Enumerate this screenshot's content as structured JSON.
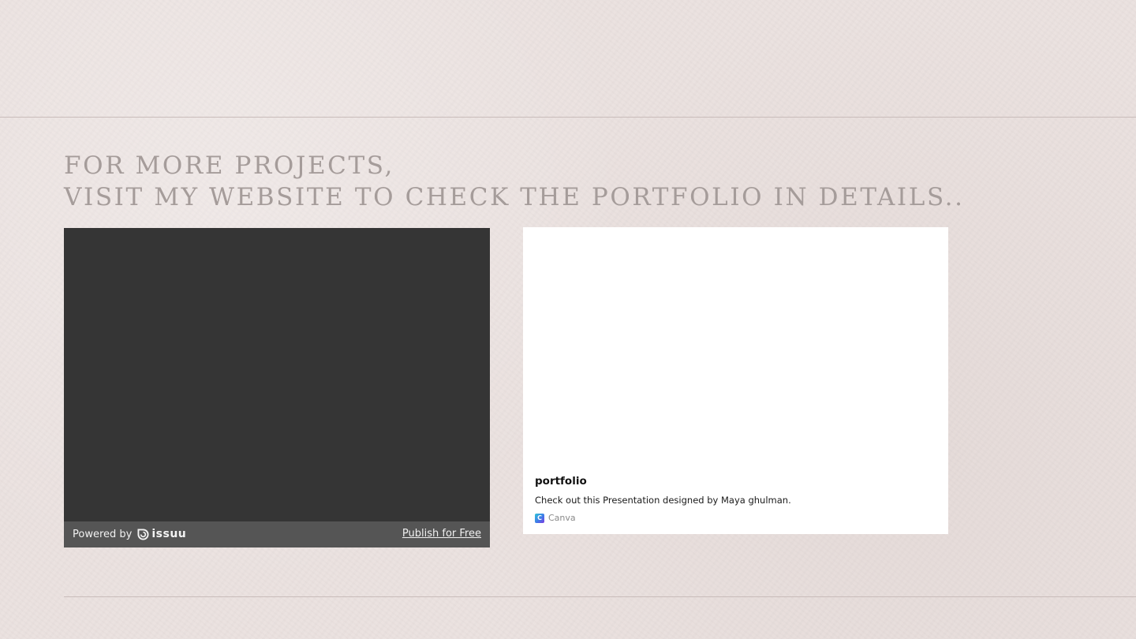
{
  "heading": {
    "line1": "For more projects,",
    "line2": "visit my website to check the portfolio in details.."
  },
  "issuu": {
    "powered_by": "Powered by",
    "brand": "issuu",
    "publish_link": "Publish for Free"
  },
  "canva": {
    "title": "portfolio",
    "description": "Check out this Presentation designed by Maya ghulman.",
    "source": "Canva",
    "icon_letter": "C"
  },
  "colors": {
    "background": "#ebe2e0",
    "heading_text": "#a59c9a",
    "issuu_viewer": "#353535",
    "issuu_footer": "#555555",
    "card_background": "#ffffff"
  },
  "icons": {
    "issuu_logo": "issuu-logo-icon",
    "canva_logo": "canva-logo-icon"
  }
}
